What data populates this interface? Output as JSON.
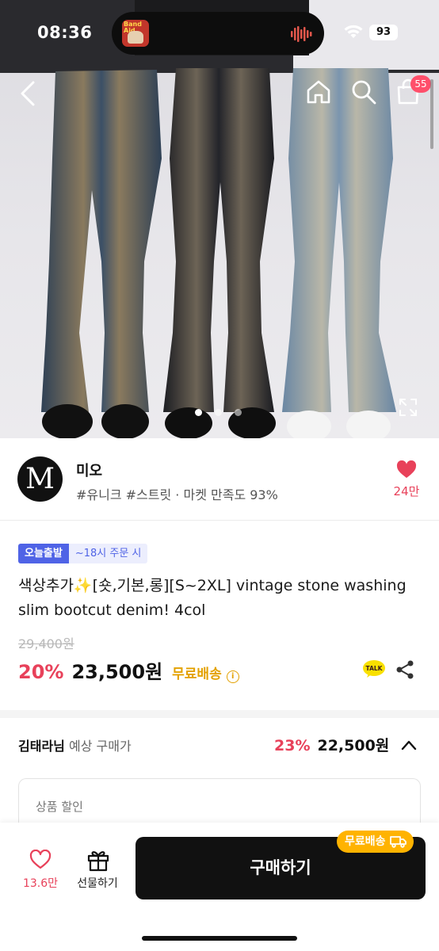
{
  "status_bar": {
    "time": "08:36",
    "battery": "93",
    "album_text": "Band Aid"
  },
  "header": {
    "cart_count": "55"
  },
  "icons": {
    "back": "chevron-left-icon",
    "home": "home-icon",
    "search": "search-icon",
    "cart": "shopping-bag-icon",
    "expand": "expand-icon",
    "heart": "heart-icon",
    "gift": "gift-icon",
    "share": "share-icon",
    "talk": "kakaotalk-icon"
  },
  "carousel": {
    "pages": 3,
    "active": 1
  },
  "seller": {
    "logo_letter": "M",
    "name": "미오",
    "meta": "#유니크 #스트릿 · 마켓 만족도 93%",
    "likes": "24만"
  },
  "product": {
    "badge_primary": "오늘출발",
    "badge_secondary": "~18시 주문 시",
    "title": "색상추가✨[숏,기본,롱][S~2XL] vintage stone washing slim bootcut denim! 4col",
    "original_price": "29,400원",
    "discount": "20%",
    "price": "23,500원",
    "shipping": "무료배송",
    "talk_label": "TALK"
  },
  "expected": {
    "user": "김태라님",
    "label": "예상 구매가",
    "rate": "23%",
    "price": "22,500원",
    "discount_section_label": "상품 할인"
  },
  "bottom_bar": {
    "likes": "13.6만",
    "gift_label": "선물하기",
    "buy_label": "구매하기",
    "free_tag": "무료배송"
  },
  "colors": {
    "accent_red": "#e8415a",
    "badge_blue": "#4f63e6",
    "shipping_yellow": "#e3a100",
    "buy_button": "#111111"
  }
}
